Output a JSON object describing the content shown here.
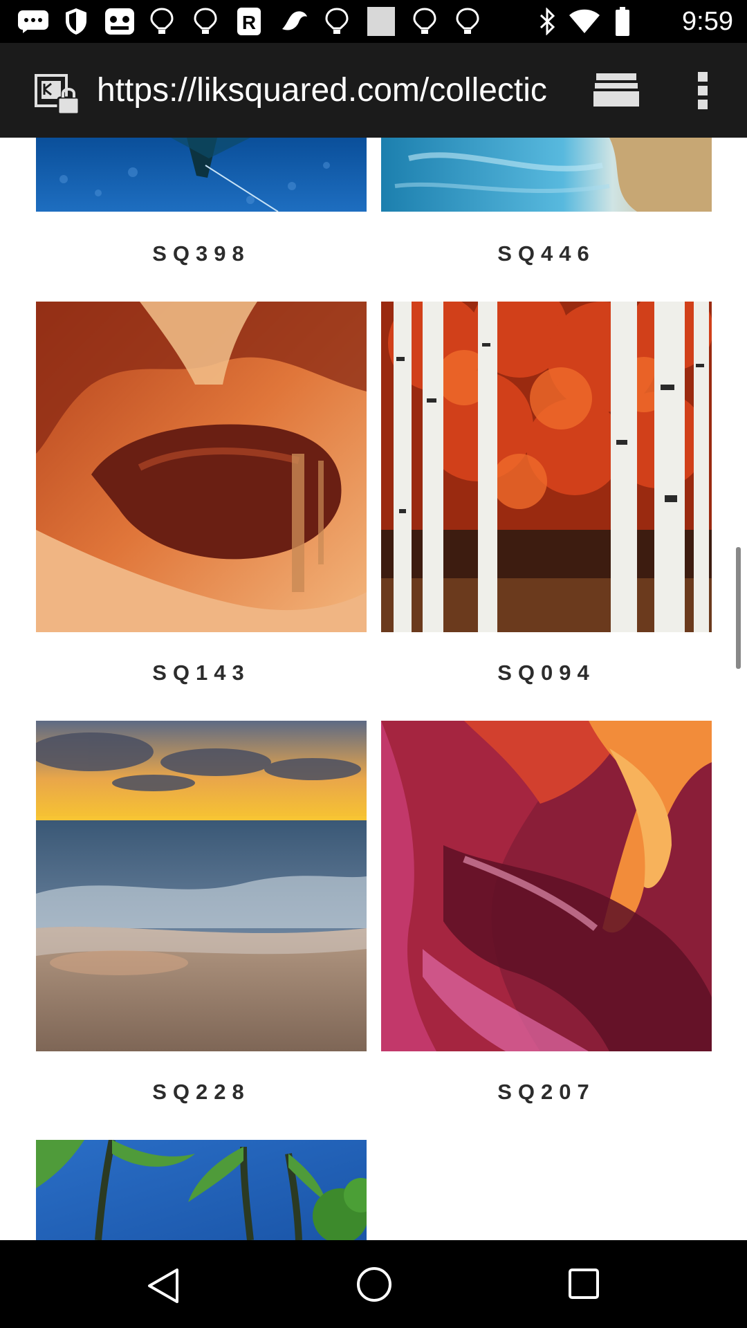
{
  "status_bar": {
    "time": "9:59",
    "icons": [
      "messages-icon",
      "shield-icon",
      "game-icon",
      "bulb-icon",
      "bulb-icon",
      "bulb-icon",
      "r-app-icon",
      "bird-icon",
      "bulb-icon",
      "gallery-icon",
      "bulb-icon",
      "bulb-icon",
      "bluetooth-icon",
      "wifi-icon",
      "battery-icon"
    ]
  },
  "browser": {
    "url": "https://liksquared.com/collectic"
  },
  "gallery": {
    "items": [
      {
        "code": "SQ398",
        "scene": "underwater-blue"
      },
      {
        "code": "SQ446",
        "scene": "beach-turquoise"
      },
      {
        "code": "SQ143",
        "scene": "slot-canyon-orange"
      },
      {
        "code": "SQ094",
        "scene": "birch-forest-red"
      },
      {
        "code": "SQ228",
        "scene": "ocean-sunset"
      },
      {
        "code": "SQ207",
        "scene": "canyon-red-pink"
      },
      {
        "code": "",
        "scene": "palm-trees"
      }
    ]
  },
  "nav_bar": {
    "icons": [
      "back-icon",
      "home-icon",
      "recents-icon"
    ]
  }
}
